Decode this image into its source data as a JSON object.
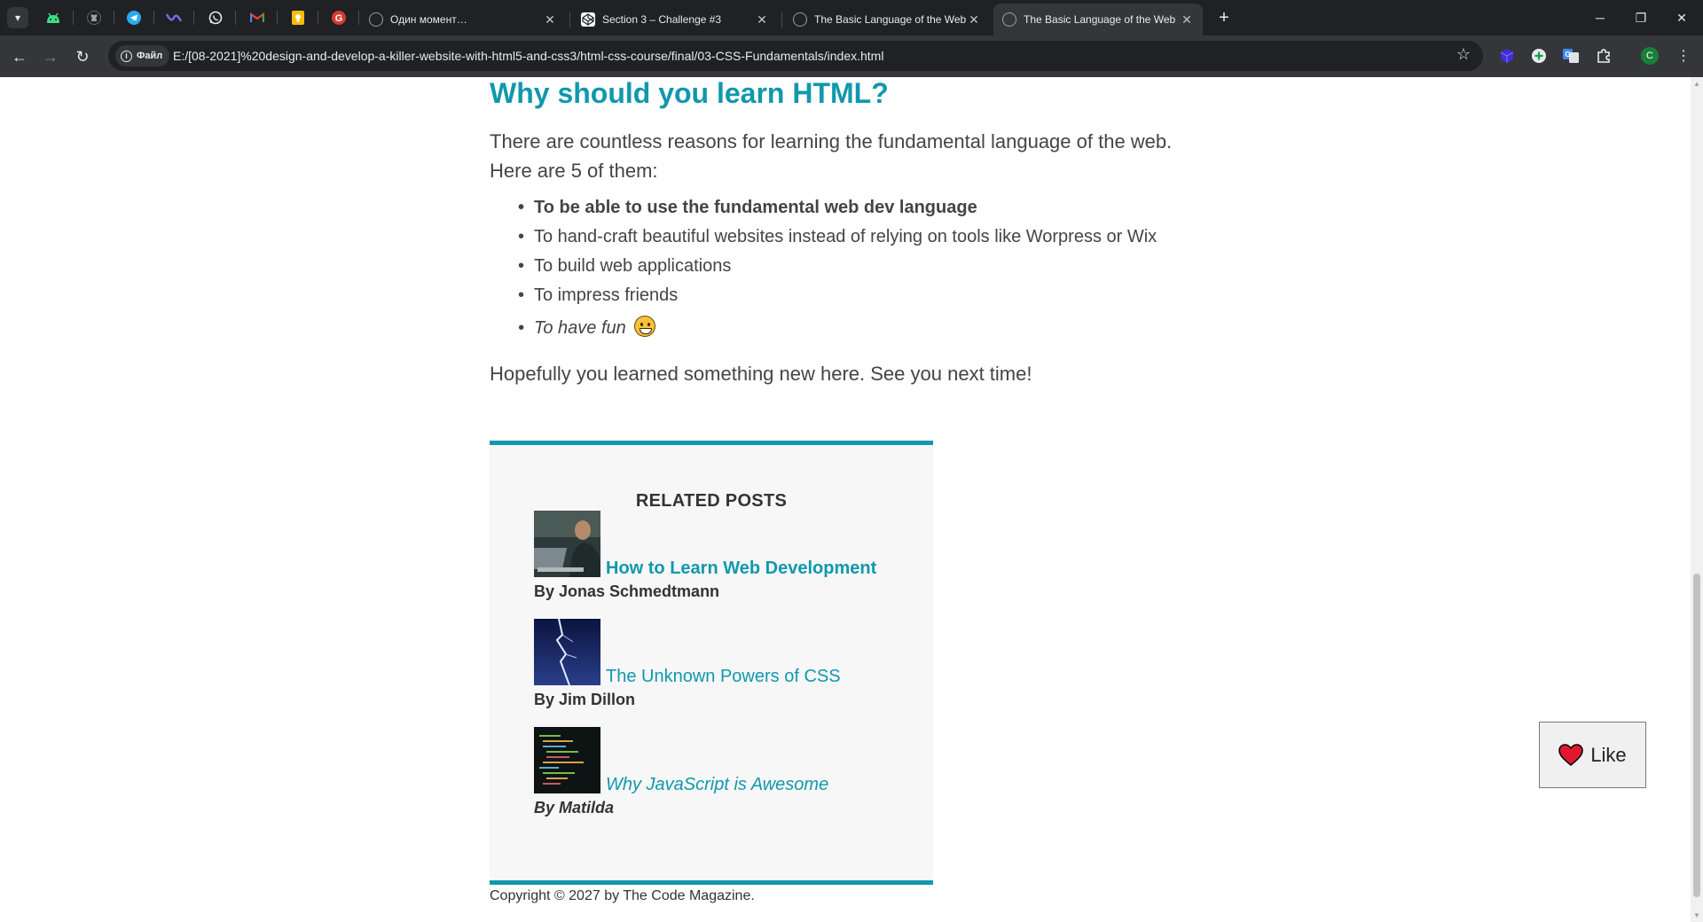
{
  "browser": {
    "tabs": [
      {
        "title": "Один момент…",
        "favicon": "globe-icon",
        "active": false
      },
      {
        "title": "Section 3 – Challenge #3",
        "favicon": "codepen-icon",
        "active": false
      },
      {
        "title": "The Basic Language of the Web",
        "favicon": "globe-icon",
        "active": false
      },
      {
        "title": "The Basic Language of the Web",
        "favicon": "globe-icon",
        "active": true
      }
    ],
    "pinned_tabs": [
      "android-icon",
      "github-icon",
      "telegram-icon",
      "app-icon",
      "whatsapp-icon",
      "gmail-icon",
      "keep-icon",
      "grammarly-icon"
    ],
    "new_tab_label": "+",
    "address": {
      "chip_label": "Файл",
      "url": "E:/[08-2021]%20design-and-develop-a-killer-website-with-html5-and-css3/html-css-course/final/03-CSS-Fundamentals/index.html"
    },
    "profile_initial": "C"
  },
  "article": {
    "heading": "Why should you learn HTML?",
    "intro": "There are countless reasons for learning the fundamental language of the web. Here are 5 of them:",
    "reasons": [
      "To be able to use the fundamental web dev language",
      "To hand-craft beautiful websites instead of relying on tools like Worpress or Wix",
      "To build web applications",
      "To impress friends",
      "To have fun"
    ],
    "outro": "Hopefully you learned something new here. See you next time!"
  },
  "related": {
    "heading": "RELATED POSTS",
    "posts": [
      {
        "title": "How to Learn Web Development",
        "author": "By Jonas Schmedtmann"
      },
      {
        "title": "The Unknown Powers of CSS",
        "author": "By Jim Dillon"
      },
      {
        "title": "Why JavaScript is Awesome",
        "author": "By Matilda"
      }
    ]
  },
  "footer": {
    "copyright": "Copyright © 2027 by The Code Magazine."
  },
  "like_button": {
    "label": "Like"
  },
  "colors": {
    "accent": "#1098ad",
    "text": "#444444",
    "aside_bg": "#f7f7f7"
  }
}
